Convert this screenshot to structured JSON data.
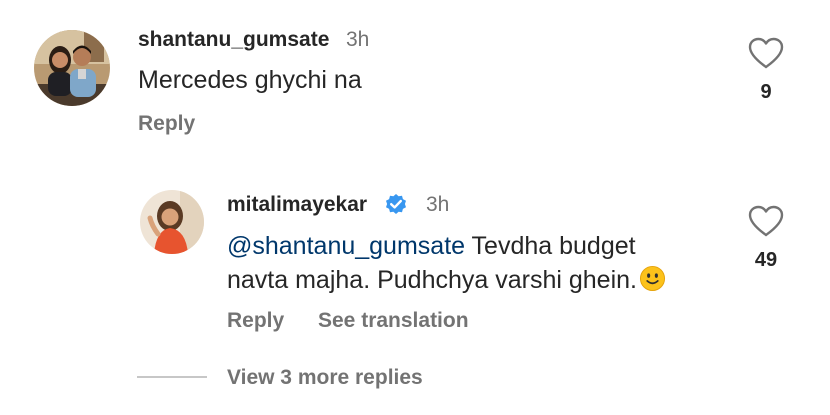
{
  "comment": {
    "username": "shantanu_gumsate",
    "time": "3h",
    "text": "Mercedes ghychi na",
    "reply_label": "Reply",
    "likes": "9",
    "avatar_icon": "profile-photo-couple",
    "heart_icon": "heart-outline-icon"
  },
  "reply": {
    "username": "mitalimayekar",
    "verified_icon": "verified-badge-icon",
    "verified_color": "#3897f0",
    "time": "3h",
    "mention": "@shantanu_gumsate",
    "text_line1": " Tevdha budget",
    "text_line2": "navta majha. Pudhchya varshi ghein.",
    "emoji": "slightly-smiling-face",
    "reply_label": "Reply",
    "translate_label": "See translation",
    "likes": "49",
    "avatar_icon": "profile-photo-woman"
  },
  "more_replies": {
    "label": "View 3 more replies"
  },
  "colors": {
    "text": "#262626",
    "secondary": "#737373",
    "mention": "#00376b",
    "divider": "#c7c7c7"
  }
}
